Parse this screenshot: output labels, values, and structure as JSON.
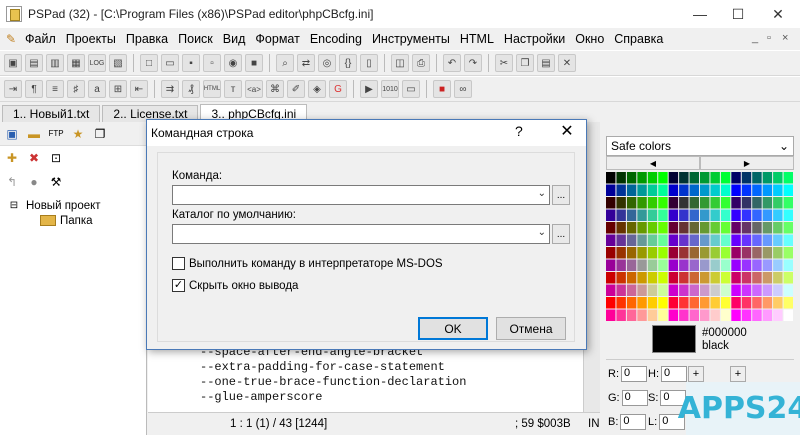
{
  "window": {
    "title": "PSPad (32) - [C:\\Program Files (x86)\\PSPad editor\\phpCBcfg.ini]",
    "controls": [
      "—",
      "☐",
      "✕"
    ]
  },
  "menu": {
    "items": [
      "Файл",
      "Проекты",
      "Правка",
      "Поиск",
      "Вид",
      "Формат",
      "Encoding",
      "Инструменты",
      "HTML",
      "Настройки",
      "Окно",
      "Справка"
    ],
    "right_controls": [
      "_",
      "▫",
      "×"
    ]
  },
  "toolbar1": [
    "project-icon",
    "open-icon",
    "save-icon",
    "copy-icon",
    "log-icon",
    "page-icon",
    "new-icon",
    "open-file-icon",
    "save-file-icon",
    "print-icon",
    "palette-icon",
    "block-icon",
    "search-icon",
    "replace-icon",
    "find-icon",
    "braces-icon",
    "columns-icon",
    "preview-icon",
    "print2-icon",
    "undo-icon",
    "redo-icon",
    "cut-icon",
    "copy2-icon",
    "paste-icon",
    "delete-icon"
  ],
  "toolbar2": [
    "para-icon",
    "para2-icon",
    "list-icon",
    "code-icon",
    "text-icon",
    "tree-icon",
    "arrow-icon",
    "indent-icon",
    "chars-icon",
    "html-icon",
    "text-small-icon",
    "tag-icon",
    "code2-icon",
    "edit-icon",
    "view-icon",
    "google-icon",
    "play-icon",
    "binary-icon",
    "terminal-icon",
    "stop-icon",
    "glasses-icon"
  ],
  "tabs": [
    "1.. Новый1.txt",
    "2.. License.txt",
    "3.. phpCBcfg.ini"
  ],
  "active_tab": 2,
  "project_tree": {
    "root": "Новый проект",
    "child": "Папка"
  },
  "code_lines": [
    "--space-after-end-angle-bracket",
    "--extra-padding-for-case-statement",
    "--one-true-brace-function-declaration",
    "--glue-amperscore"
  ],
  "status": {
    "position": "1 : 1 (1) / 43  [1244]",
    "char": ";  59 $003B",
    "mode": "IN"
  },
  "color_panel": {
    "dropdown": "Safe colors",
    "hex": "#000000",
    "name": "black",
    "fields": {
      "R": "0",
      "G": "0",
      "B": "0",
      "H": "0",
      "S": "0",
      "L": "0"
    }
  },
  "dialog": {
    "title": "Командная строка",
    "help": "?",
    "close": "✕",
    "command_label": "Команда:",
    "command_value": "",
    "dir_label": "Каталог по умолчанию:",
    "dir_value": "",
    "dots": "...",
    "check_msdos": "Выполнить команду в интерпретаторе MS-DOS",
    "check_msdos_checked": false,
    "check_hide": "Скрыть окно вывода",
    "check_hide_checked": true,
    "ok": "OK",
    "cancel": "Отмена"
  },
  "watermark": "APPS24"
}
